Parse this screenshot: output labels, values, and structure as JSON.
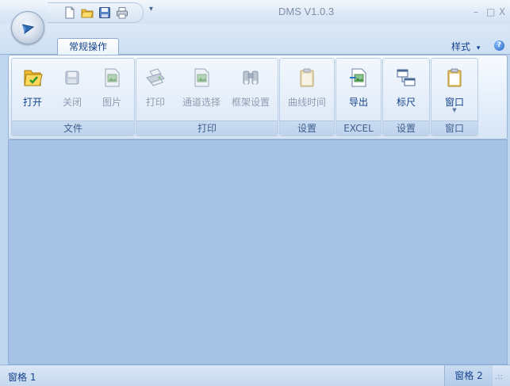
{
  "window": {
    "title": "DMS V1.0.3",
    "minimize_glyph": "–",
    "maximize_glyph": "□",
    "close_glyph": "X"
  },
  "quick_access": {
    "icons": [
      "new-document-icon",
      "open-folder-icon",
      "save-icon",
      "print-icon"
    ],
    "more_glyph": "▾"
  },
  "tabs": [
    {
      "label": "常规操作",
      "active": true
    }
  ],
  "style_menu": {
    "label": "样式",
    "caret": "▾"
  },
  "help": {
    "glyph": "?"
  },
  "ribbon": {
    "groups": [
      {
        "label": "文件",
        "buttons": [
          {
            "label": "打开",
            "icon": "open-folder-icon",
            "enabled": true
          },
          {
            "label": "关闭",
            "icon": "save-disk-icon",
            "enabled": false
          },
          {
            "label": "图片",
            "icon": "image-document-icon",
            "enabled": false
          }
        ]
      },
      {
        "label": "打印",
        "buttons": [
          {
            "label": "打印",
            "icon": "printer-icon",
            "enabled": false
          },
          {
            "label": "通道选择",
            "icon": "channel-document-icon",
            "enabled": false
          },
          {
            "label": "框架设置",
            "icon": "binoculars-icon",
            "enabled": false
          }
        ]
      },
      {
        "label": "设置",
        "buttons": [
          {
            "label": "曲线时间",
            "icon": "clipboard-icon",
            "enabled": false
          }
        ]
      },
      {
        "label": "EXCEL",
        "buttons": [
          {
            "label": "导出",
            "icon": "export-document-icon",
            "enabled": true
          }
        ]
      },
      {
        "label": "设置",
        "buttons": [
          {
            "label": "标尺",
            "icon": "ruler-windows-icon",
            "enabled": true
          }
        ]
      },
      {
        "label": "窗口",
        "buttons": [
          {
            "label": "窗口",
            "icon": "window-clipboard-icon",
            "enabled": true,
            "dropdown": true
          }
        ]
      }
    ]
  },
  "status_bar": {
    "pane1": "窗格 1",
    "pane2": "窗格 2",
    "grip": ".::"
  },
  "colors": {
    "accent": "#15428b",
    "client_bg": "#a6c3e6",
    "ribbon_bg": "#e4eefa"
  }
}
